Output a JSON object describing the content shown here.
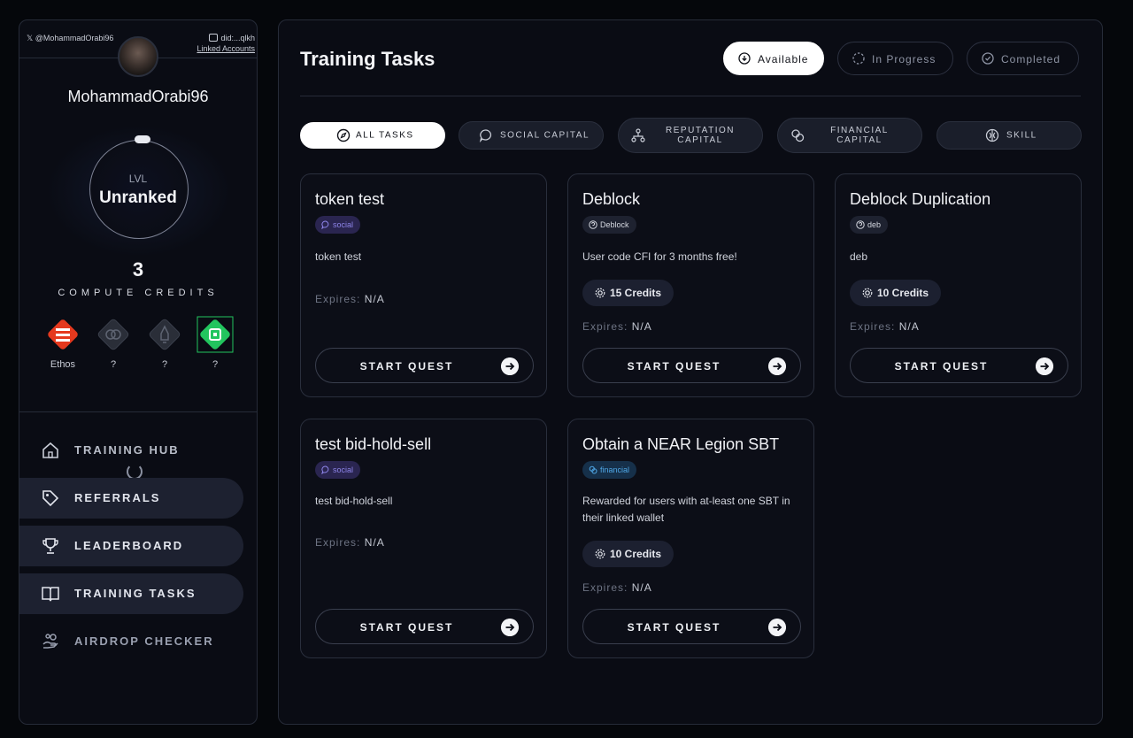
{
  "sidebar": {
    "x_handle": "@MohammadOrabi96",
    "did": "did:...qlkh",
    "linked_accounts": "Linked Accounts",
    "username": "MohammadOrabi96",
    "level_label": "LVL",
    "level_value": "Unranked",
    "credits_count": "3",
    "credits_label": "COMPUTE CREDITS",
    "badges": [
      {
        "label": "Ethos",
        "icon": "ethos-icon",
        "color": "#e5391e"
      },
      {
        "label": "?",
        "icon": "brain-icon",
        "color": "#2a2e38"
      },
      {
        "label": "?",
        "icon": "rocket-icon",
        "color": "#2a2e38"
      },
      {
        "label": "?",
        "icon": "chip-icon",
        "color": "#22c55e"
      }
    ],
    "nav": [
      {
        "label": "TRAINING HUB",
        "icon": "home-icon"
      },
      {
        "label": "REFERRALS",
        "icon": "tag-icon"
      },
      {
        "label": "LEADERBOARD",
        "icon": "trophy-icon"
      },
      {
        "label": "TRAINING TASKS",
        "icon": "book-icon"
      },
      {
        "label": "AIRDROP CHECKER",
        "icon": "airdrop-icon"
      }
    ]
  },
  "main": {
    "title": "Training Tasks",
    "status_tabs": [
      {
        "label": "Available",
        "active": true
      },
      {
        "label": "In Progress",
        "active": false
      },
      {
        "label": "Completed",
        "active": false
      }
    ],
    "filters": [
      {
        "label": "ALL TASKS",
        "active": true
      },
      {
        "label": "SOCIAL CAPITAL",
        "active": false
      },
      {
        "label": "REPUTATION CAPITAL",
        "active": false
      },
      {
        "label": "FINANCIAL CAPITAL",
        "active": false
      },
      {
        "label": "SKILL",
        "active": false
      }
    ],
    "expires_label": "Expires:",
    "start_label": "START QUEST",
    "cards": [
      {
        "title": "token test",
        "tag": "social",
        "desc": "token test",
        "credits": "",
        "expires": "N/A"
      },
      {
        "title": "Deblock",
        "tag": "Deblock",
        "desc": "User code CFI for 3 months free!",
        "credits": "15 Credits",
        "expires": "N/A"
      },
      {
        "title": "Deblock Duplication",
        "tag": "deb",
        "desc": "deb",
        "credits": "10 Credits",
        "expires": "N/A"
      },
      {
        "title": "test bid-hold-sell",
        "tag": "social",
        "desc": "test bid-hold-sell",
        "credits": "",
        "expires": "N/A"
      },
      {
        "title": "Obtain a NEAR Legion SBT",
        "tag": "financial",
        "desc": "Rewarded for users with at-least one SBT in their linked wallet",
        "credits": "10 Credits",
        "expires": "N/A"
      }
    ]
  }
}
